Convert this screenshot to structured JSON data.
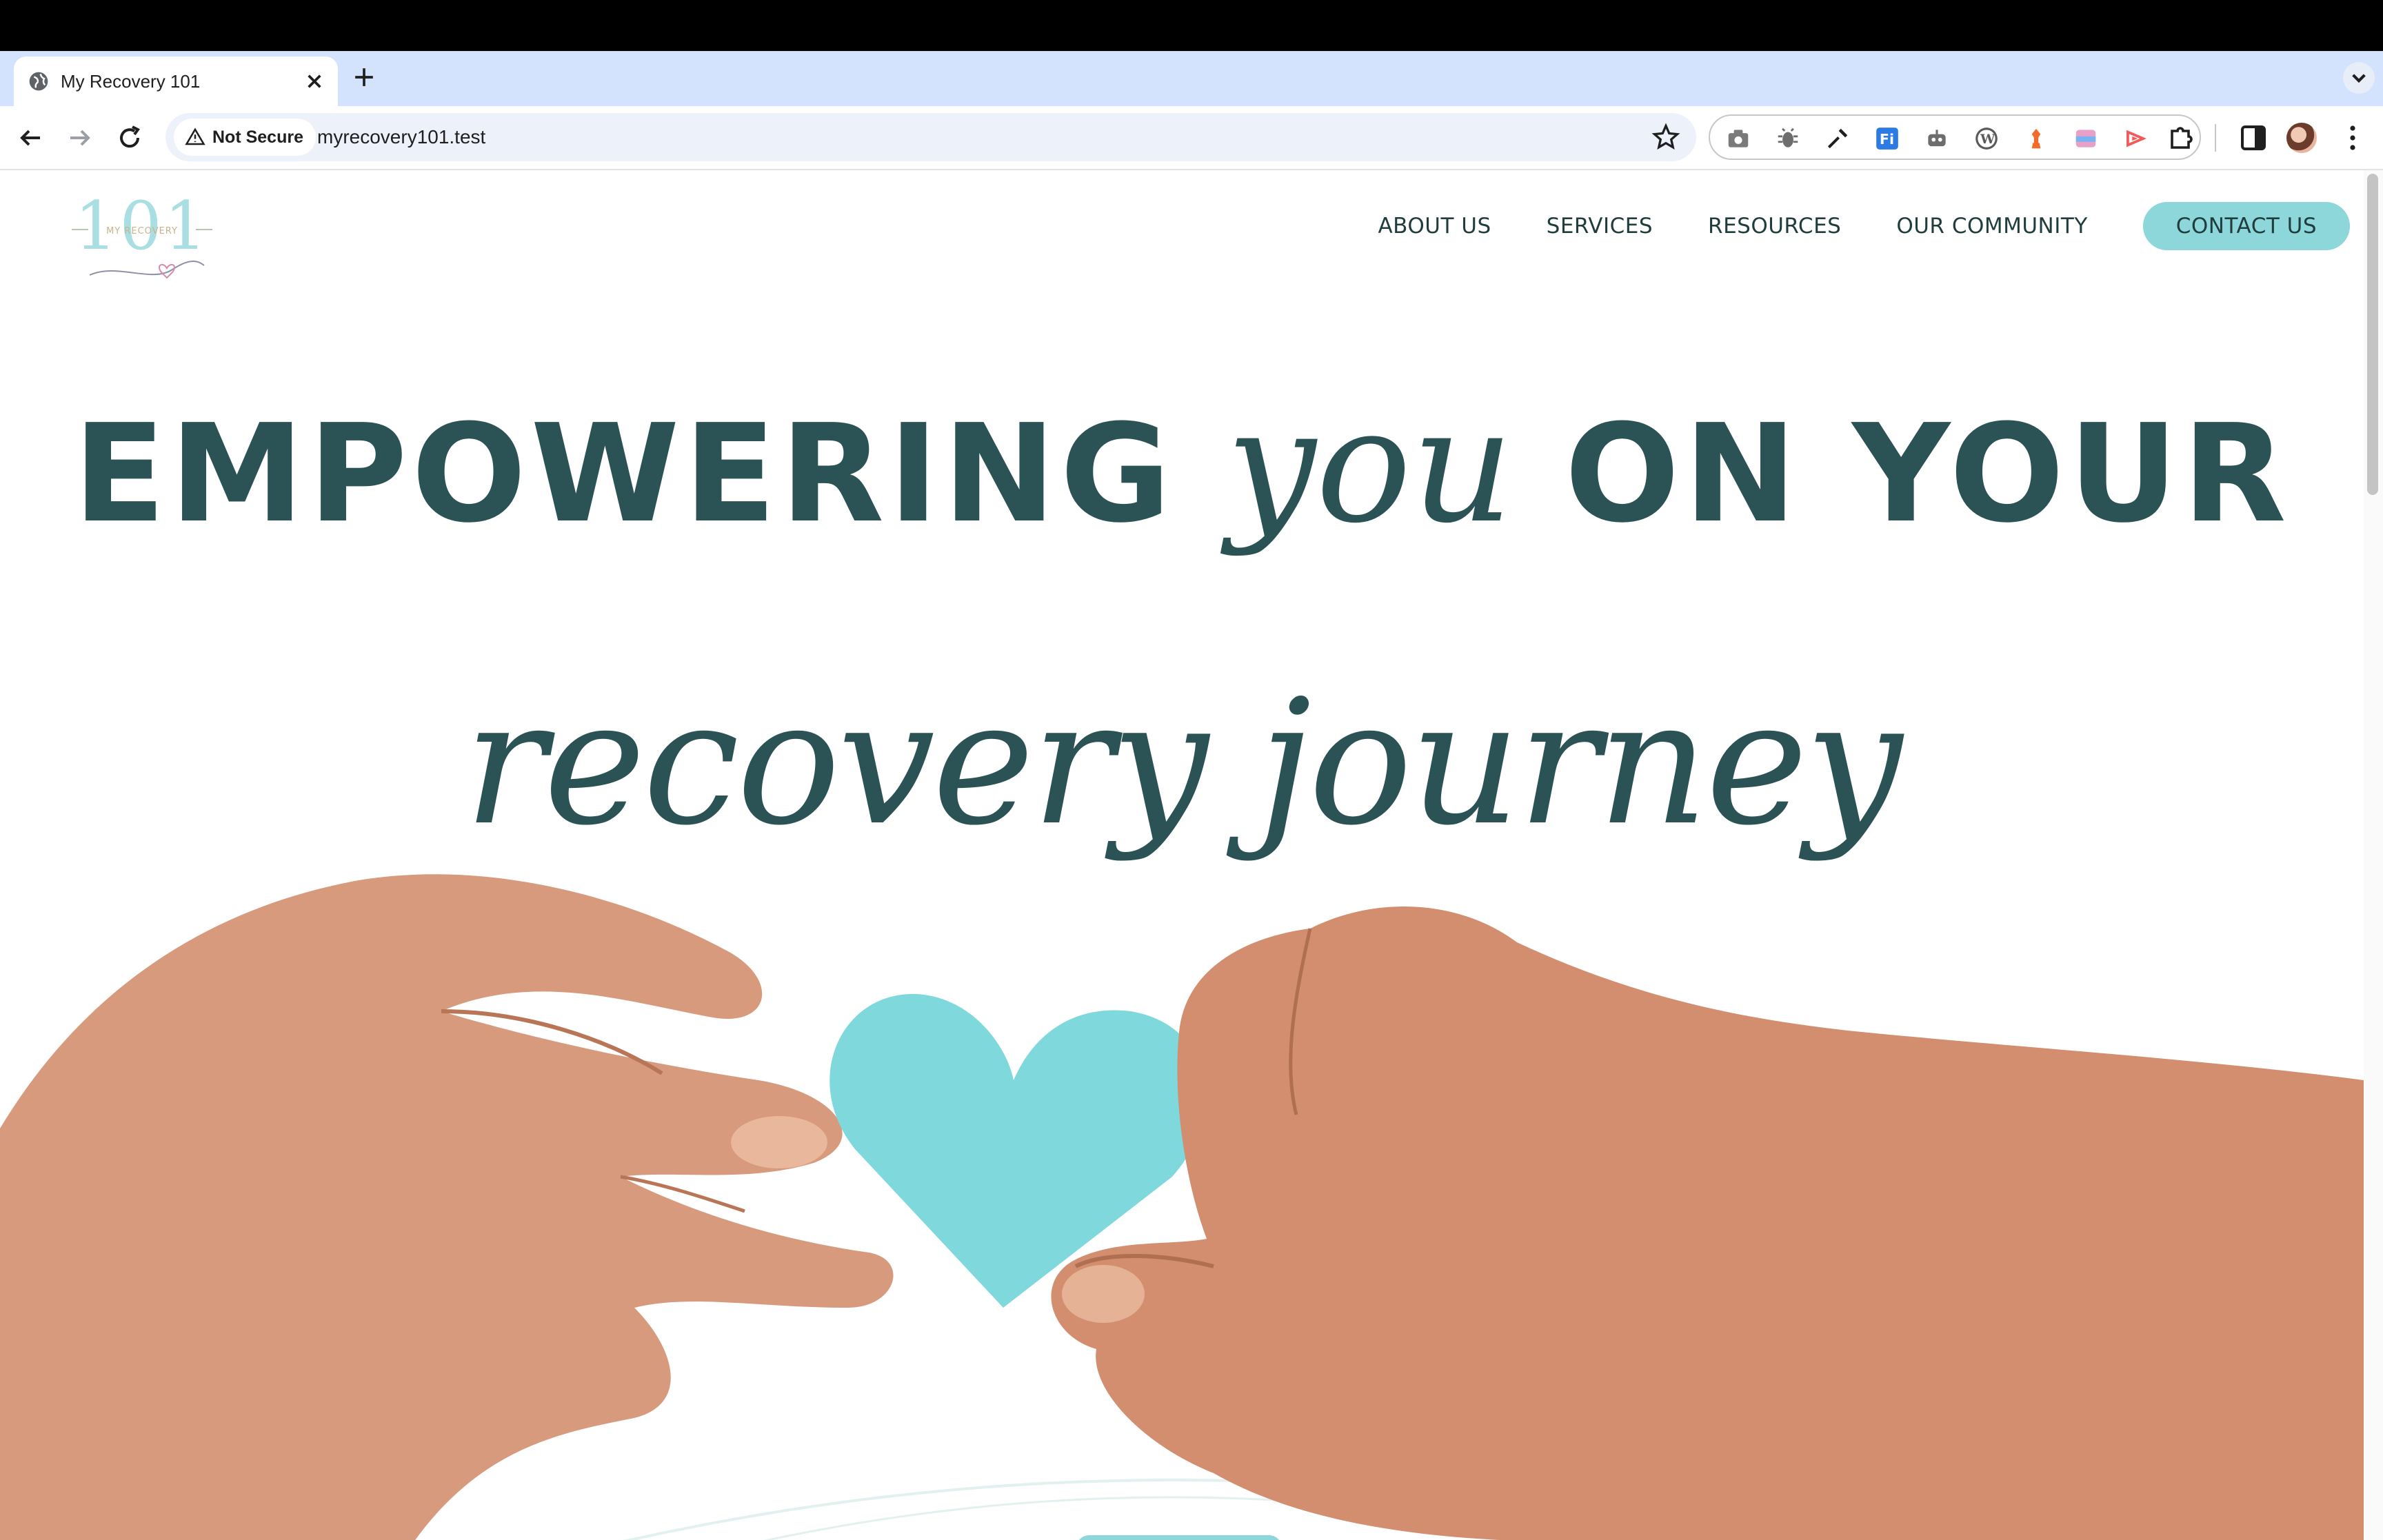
{
  "browser": {
    "tab_title": "My Recovery 101",
    "url": "myrecovery101.test",
    "security_label": "Not Secure"
  },
  "site": {
    "logo_text": "101",
    "logo_subtext": "MY RECOVERY",
    "nav": {
      "about": "ABOUT US",
      "services": "SERVICES",
      "resources": "RESOURCES",
      "community": "OUR COMMUNITY",
      "contact": "CONTACT US"
    }
  },
  "hero": {
    "line1_part1": "EMPOWERING",
    "line1_script": "you",
    "line1_part2": "ON YOUR",
    "line2": "recovery journey",
    "image_alt": "Two hands holding a paper heart"
  },
  "colors": {
    "accent": "#8dd6d9",
    "heading": "#2b5254",
    "heart": "#7fd8dc"
  }
}
